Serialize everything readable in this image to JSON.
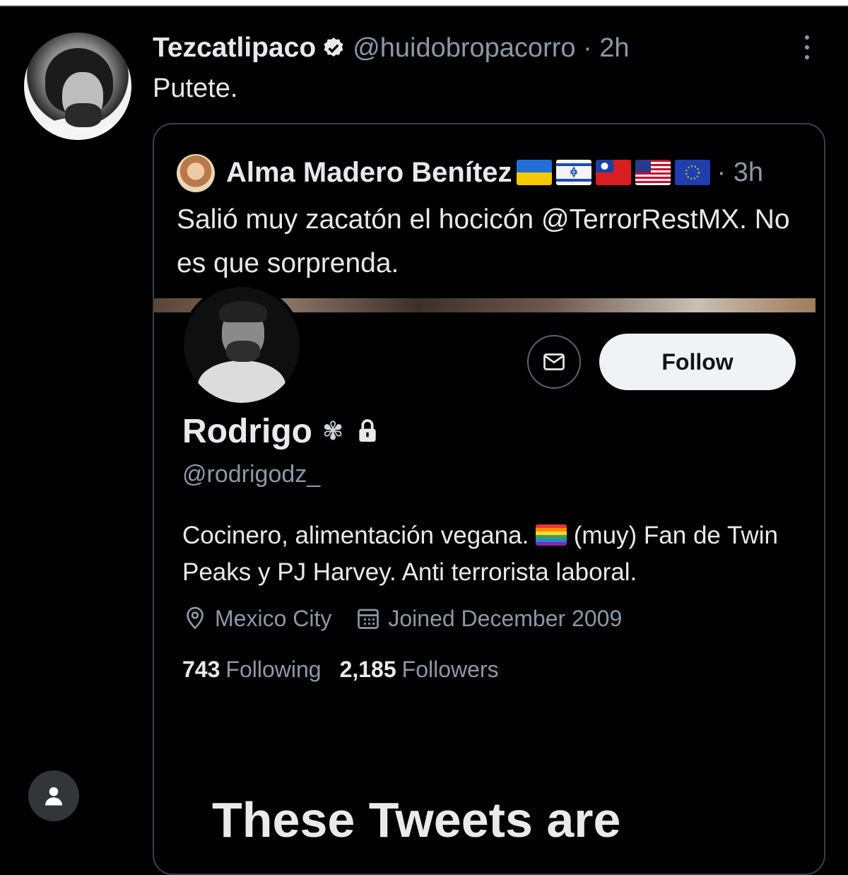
{
  "outer_tweet": {
    "display_name": "Tezcatlipaco",
    "handle_time": "@huidobropacorro · 2h",
    "text": "Putete."
  },
  "quoted_tweet": {
    "display_name": "Alma Madero Benítez",
    "flags": [
      "ukraine-flag",
      "israel-flag",
      "taiwan-flag",
      "usa-flag",
      "eu-flag"
    ],
    "time": "· 3h",
    "text": "Salió muy zacatón el hocicón @TerrorRestMX. No es que sorprenda."
  },
  "profile": {
    "name": "Rodrigo",
    "handle": "@rodrigodz_",
    "bio_part1": "Cocinero, alimentación vegana.",
    "bio_part2": "(muy) Fan de Twin Peaks y PJ Harvey. Anti terrorista laboral.",
    "location": "Mexico City",
    "joined": "Joined December 2009",
    "following_count": "743",
    "following_label": "Following",
    "followers_count": "2,185",
    "followers_label": "Followers",
    "follow_button": "Follow",
    "protected_notice": "These Tweets are"
  },
  "colors": {
    "background": "#000000",
    "text_primary": "#e7e9ea",
    "text_secondary": "#8b98a5",
    "follow_button_bg": "#eff3f4"
  }
}
